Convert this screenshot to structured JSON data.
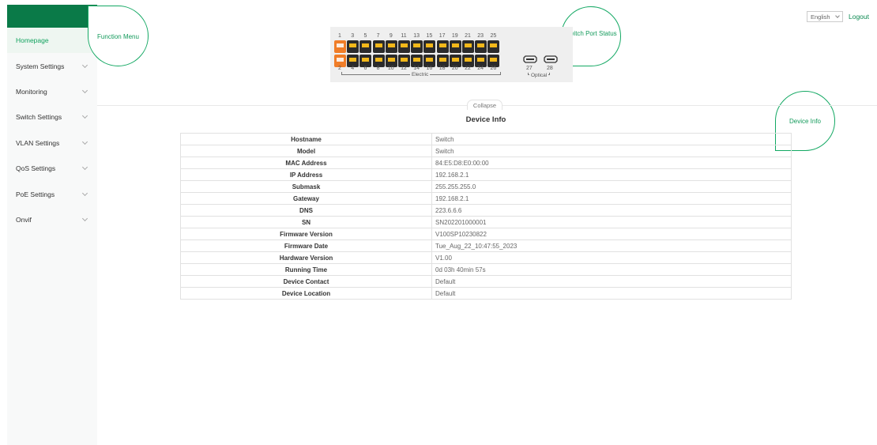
{
  "sidebar": {
    "items": [
      {
        "label": "Homepage",
        "active": true,
        "expandable": false
      },
      {
        "label": "System Settings",
        "expandable": true
      },
      {
        "label": "Monitoring",
        "expandable": true
      },
      {
        "label": "Switch Settings",
        "expandable": true
      },
      {
        "label": "VLAN Settings",
        "expandable": true
      },
      {
        "label": "QoS Settings",
        "expandable": true
      },
      {
        "label": "PoE Settings",
        "expandable": true
      },
      {
        "label": "Onvif",
        "expandable": true
      }
    ]
  },
  "callouts": {
    "function_menu": "Function Menu",
    "switch_port_status": "Switch Port Status",
    "device_info": "Device Info"
  },
  "header": {
    "language": "English",
    "logout": "Logout"
  },
  "ports": {
    "top_numbers": [
      "1",
      "3",
      "5",
      "7",
      "9",
      "11",
      "13",
      "15",
      "17",
      "19",
      "21",
      "23",
      "25"
    ],
    "bottom_numbers": [
      "2",
      "4",
      "6",
      "8",
      "10",
      "12",
      "14",
      "16",
      "18",
      "20",
      "22",
      "24",
      "26"
    ],
    "active_ports": [
      "1",
      "2"
    ],
    "electric_label": "Electric",
    "optical_numbers": [
      "27",
      "28"
    ],
    "optical_label": "Optical"
  },
  "collapse_label": "Collapse",
  "device_info": {
    "title": "Device Info",
    "rows": [
      {
        "key": "Hostname",
        "value": "Switch"
      },
      {
        "key": "Model",
        "value": "Switch"
      },
      {
        "key": "MAC Address",
        "value": "84:E5:D8:E0:00:00"
      },
      {
        "key": "IP Address",
        "value": "192.168.2.1"
      },
      {
        "key": "Submask",
        "value": "255.255.255.0"
      },
      {
        "key": "Gateway",
        "value": "192.168.2.1"
      },
      {
        "key": "DNS",
        "value": "223.6.6.6"
      },
      {
        "key": "SN",
        "value": "SN202201000001"
      },
      {
        "key": "Firmware Version",
        "value": "V100SP10230822"
      },
      {
        "key": "Firmware Date",
        "value": "Tue_Aug_22_10:47:55_2023"
      },
      {
        "key": "Hardware Version",
        "value": "V1.00"
      },
      {
        "key": "Running Time",
        "value": "0d 03h 40min 57s"
      },
      {
        "key": "Device Contact",
        "value": "Default"
      },
      {
        "key": "Device Location",
        "value": "Default"
      }
    ]
  },
  "colors": {
    "brand": "#0a7a48",
    "accent": "#12a35f",
    "port_active": "#f07d28",
    "port_link": "#f2b81a"
  }
}
